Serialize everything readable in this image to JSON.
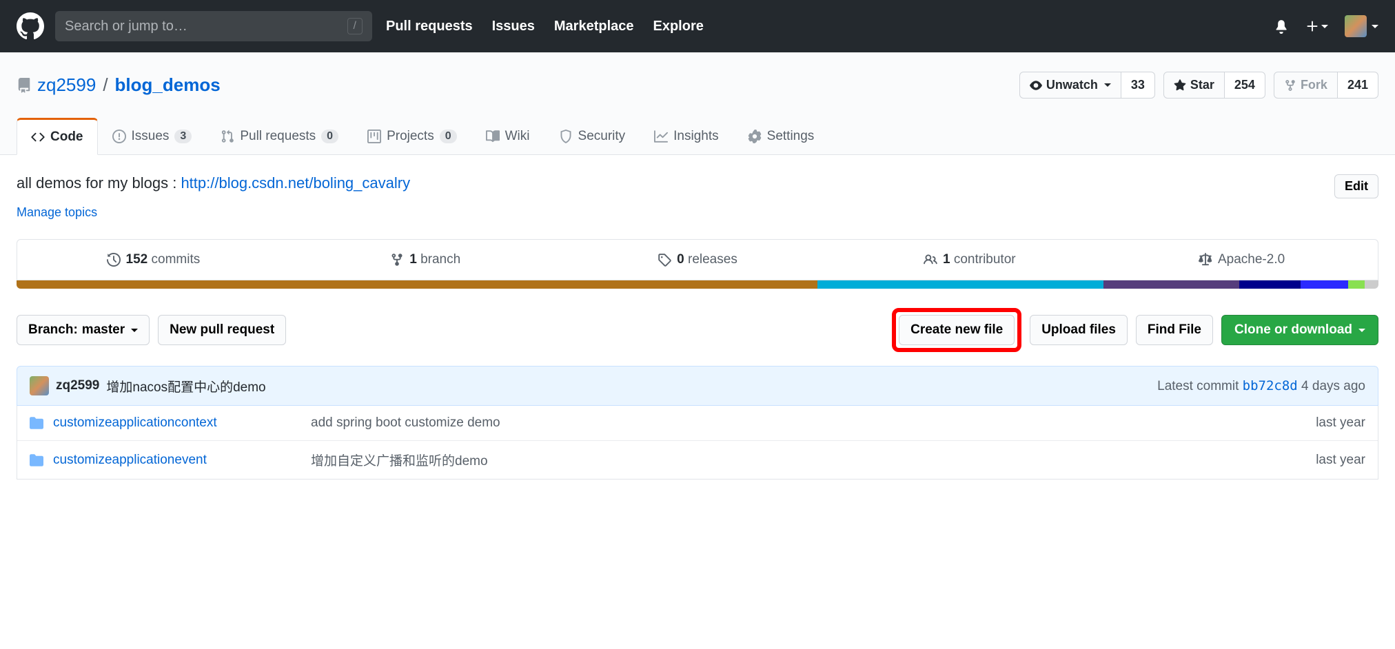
{
  "header": {
    "search_placeholder": "Search or jump to…",
    "nav": [
      "Pull requests",
      "Issues",
      "Marketplace",
      "Explore"
    ]
  },
  "repo": {
    "owner": "zq2599",
    "name": "blog_demos",
    "unwatch_label": "Unwatch",
    "watch_count": "33",
    "star_label": "Star",
    "star_count": "254",
    "fork_label": "Fork",
    "fork_count": "241"
  },
  "tabs": {
    "code": "Code",
    "issues": "Issues",
    "issues_count": "3",
    "pulls": "Pull requests",
    "pulls_count": "0",
    "projects": "Projects",
    "projects_count": "0",
    "wiki": "Wiki",
    "security": "Security",
    "insights": "Insights",
    "settings": "Settings"
  },
  "description": {
    "text": "all demos for my blogs : ",
    "link": "http://blog.csdn.net/boling_cavalry",
    "edit": "Edit",
    "manage": "Manage topics"
  },
  "stats": {
    "commits_n": "152",
    "commits_l": "commits",
    "branches_n": "1",
    "branches_l": "branch",
    "releases_n": "0",
    "releases_l": "releases",
    "contributors_n": "1",
    "contributors_l": "contributor",
    "license": "Apache-2.0"
  },
  "langbar": [
    {
      "color": "#b07219",
      "pct": 58.8
    },
    {
      "color": "#00add8",
      "pct": 21.0
    },
    {
      "color": "#563d7c",
      "pct": 10.0
    },
    {
      "color": "#00008b",
      "pct": 4.5
    },
    {
      "color": "#2b2bff",
      "pct": 3.5
    },
    {
      "color": "#89e051",
      "pct": 1.2
    },
    {
      "color": "#cccccc",
      "pct": 1.0
    }
  ],
  "toolbar": {
    "branch_prefix": "Branch: ",
    "branch_name": "master",
    "new_pr": "New pull request",
    "create_file": "Create new file",
    "upload": "Upload files",
    "find": "Find File",
    "clone": "Clone or download"
  },
  "commit": {
    "author": "zq2599",
    "message": "增加nacos配置中心的demo",
    "latest_prefix": "Latest commit ",
    "sha": "bb72c8d",
    "time": " 4 days ago"
  },
  "files": [
    {
      "name": "customizeapplicationcontext",
      "msg": "add spring boot customize demo",
      "time": "last year"
    },
    {
      "name": "customizeapplicationevent",
      "msg": "增加自定义广播和监听的demo",
      "time": "last year"
    }
  ]
}
